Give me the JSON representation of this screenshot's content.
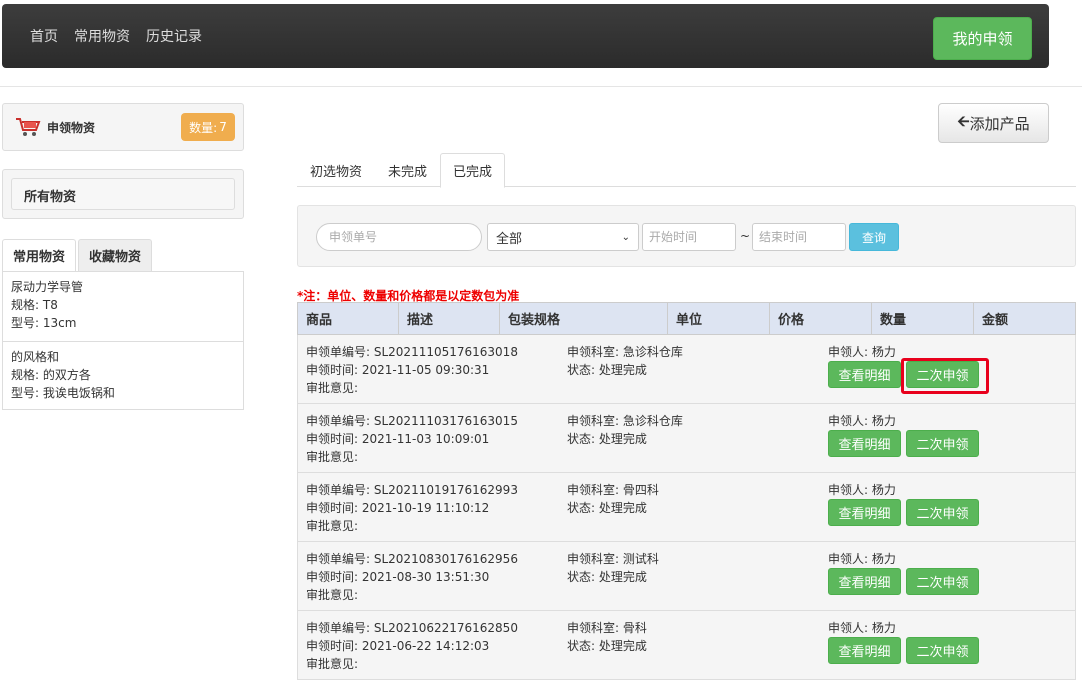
{
  "nav": {
    "links": [
      "首页",
      "常用物资",
      "历史记录"
    ],
    "my_apply_label": "我的申领"
  },
  "sidebar": {
    "cart_title": "申领物资",
    "count_label": "数量:",
    "count_value": "7",
    "all_items_label": "所有物资",
    "tabs": [
      "常用物资",
      "收藏物资"
    ],
    "items": [
      {
        "name": "尿动力学导管",
        "spec": "规格: T8",
        "model": "型号: 13cm"
      },
      {
        "name": "的风格和",
        "spec": "规格: 的双方各",
        "model": "型号: 我诶电饭锅和"
      }
    ]
  },
  "add_product_label": "添加产品",
  "main_tabs": [
    "初选物资",
    "未完成",
    "已完成"
  ],
  "search": {
    "order_placeholder": "申领单号",
    "status_value": "全部",
    "start_placeholder": "开始时间",
    "tilde": "~",
    "end_placeholder": "结束时间",
    "query_label": "查询"
  },
  "note": "*注：单位、数量和价格都是以定数包为准",
  "table": {
    "headers": [
      "商品",
      "描述",
      "包装规格",
      "单位",
      "价格",
      "数量",
      "金额"
    ],
    "detail_label": "查看明细",
    "reapply_label": "二次申领",
    "rows": [
      {
        "order": "申领单编号: SL20211105176163018",
        "time": "申领时间: 2021-11-05 09:30:31",
        "opinion": "审批意见:",
        "dept": "申领科室: 急诊科仓库",
        "status": "状态: 处理完成",
        "applicant": "申领人: 杨力"
      },
      {
        "order": "申领单编号: SL20211103176163015",
        "time": "申领时间: 2021-11-03 10:09:01",
        "opinion": "审批意见:",
        "dept": "申领科室: 急诊科仓库",
        "status": "状态: 处理完成",
        "applicant": "申领人: 杨力"
      },
      {
        "order": "申领单编号: SL20211019176162993",
        "time": "申领时间: 2021-10-19 11:10:12",
        "opinion": "审批意见:",
        "dept": "申领科室: 骨四科",
        "status": "状态: 处理完成",
        "applicant": "申领人: 杨力"
      },
      {
        "order": "申领单编号: SL20210830176162956",
        "time": "申领时间: 2021-08-30 13:51:30",
        "opinion": "审批意见:",
        "dept": "申领科室: 测试科",
        "status": "状态: 处理完成",
        "applicant": "申领人: 杨力"
      },
      {
        "order": "申领单编号: SL20210622176162850",
        "time": "申领时间: 2021-06-22 14:12:03",
        "opinion": "审批意见:",
        "dept": "申领科室: 骨科",
        "status": "状态: 处理完成",
        "applicant": "申领人: 杨力"
      }
    ]
  }
}
